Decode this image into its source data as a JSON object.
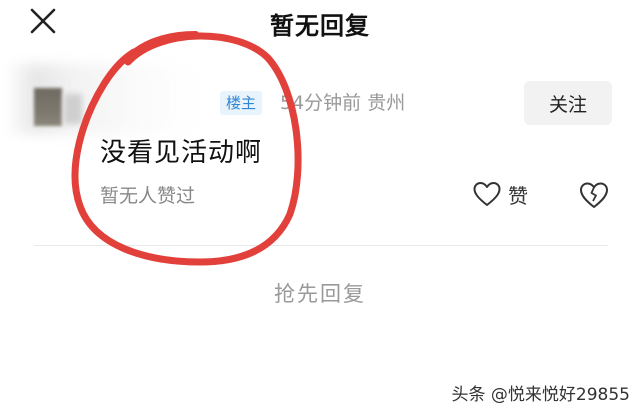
{
  "header": {
    "title": "暂无回复",
    "close_icon": "close-icon"
  },
  "comment": {
    "author_tag": "楼主",
    "time_location": "54分钟前  贵州",
    "follow_label": "关注",
    "text": "没看见活动啊",
    "like_status": "暂无人赞过",
    "like_label": "赞",
    "like_icon": "heart-outline-icon",
    "dislike_icon": "broken-heart-icon"
  },
  "reply": {
    "first_reply_label": "抢先回复"
  },
  "watermark": "头条 @悦来悦好29855",
  "colors": {
    "annotation": "#e2403a",
    "tag_bg": "#e8f3fc",
    "tag_text": "#2e86d6",
    "muted": "#999999"
  }
}
